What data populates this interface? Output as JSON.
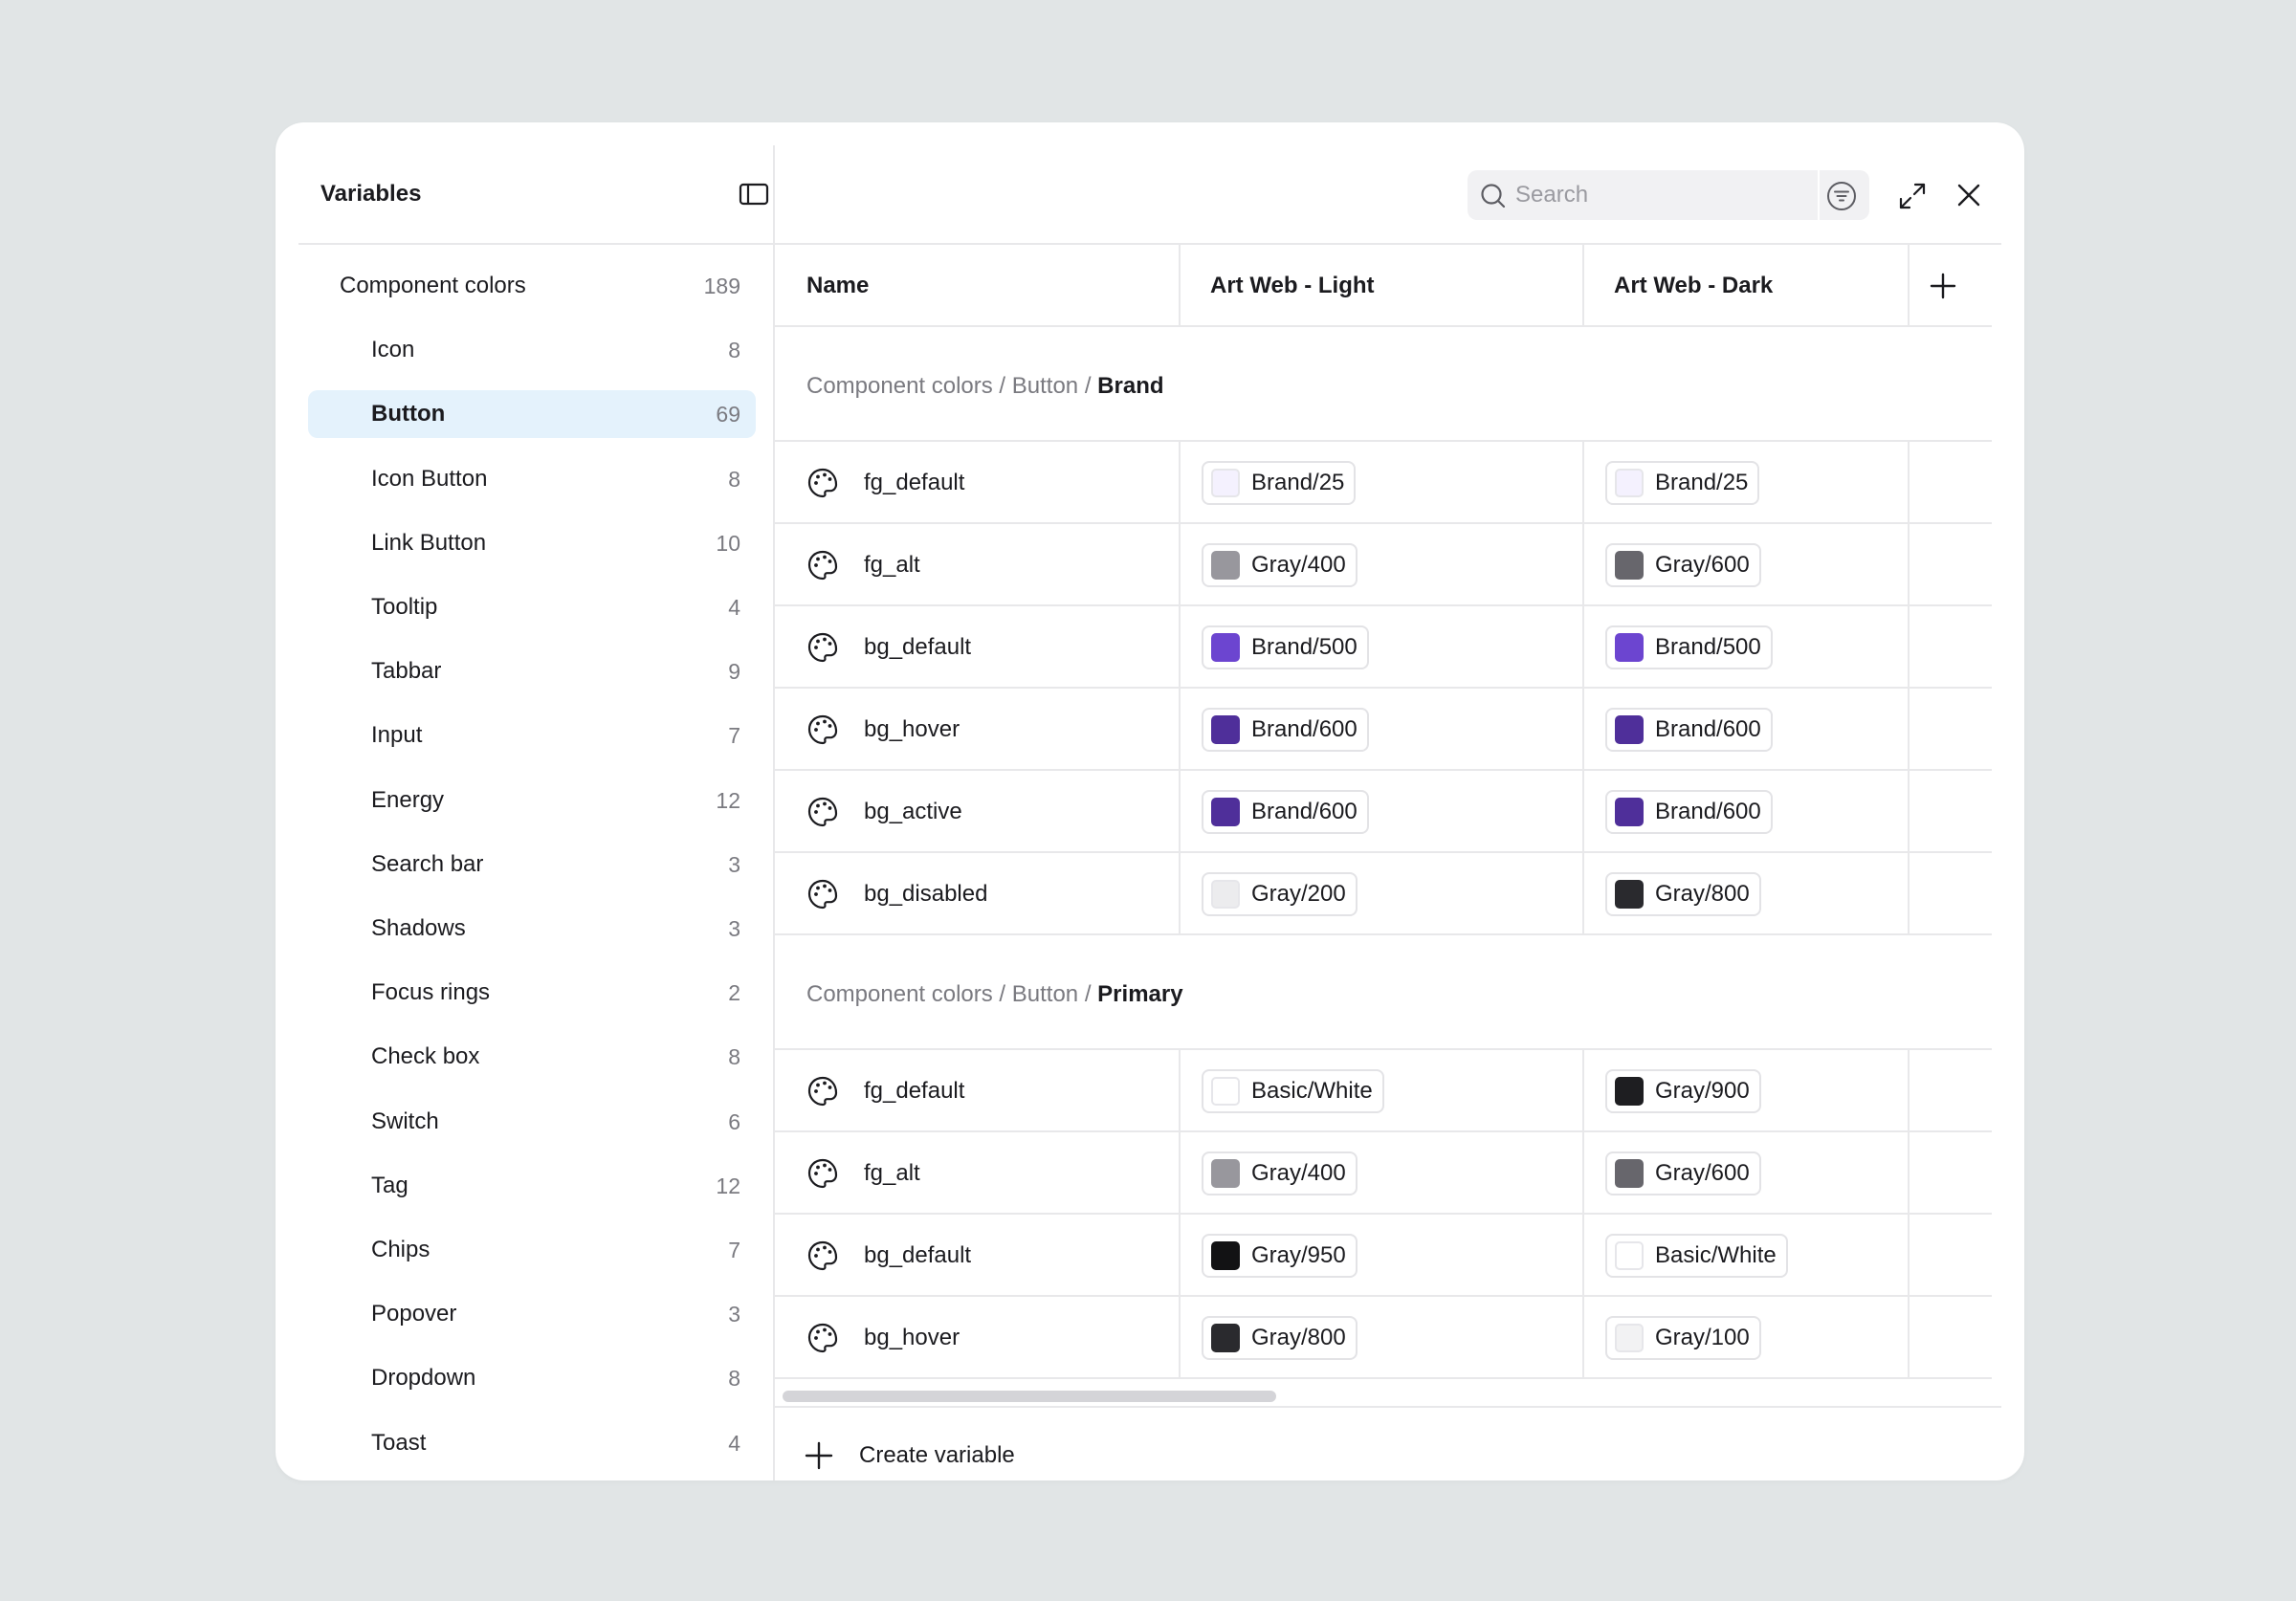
{
  "sidebar": {
    "title": "Variables",
    "items": [
      {
        "label": "Component colors",
        "count": "189",
        "level": "group",
        "selected": false
      },
      {
        "label": "Icon",
        "count": "8",
        "level": "child",
        "selected": false
      },
      {
        "label": "Button",
        "count": "69",
        "level": "child",
        "selected": true
      },
      {
        "label": "Icon Button",
        "count": "8",
        "level": "child",
        "selected": false
      },
      {
        "label": "Link Button",
        "count": "10",
        "level": "child",
        "selected": false
      },
      {
        "label": "Tooltip",
        "count": "4",
        "level": "child",
        "selected": false
      },
      {
        "label": "Tabbar",
        "count": "9",
        "level": "child",
        "selected": false
      },
      {
        "label": "Input",
        "count": "7",
        "level": "child",
        "selected": false
      },
      {
        "label": "Energy",
        "count": "12",
        "level": "child",
        "selected": false
      },
      {
        "label": "Search bar",
        "count": "3",
        "level": "child",
        "selected": false
      },
      {
        "label": "Shadows",
        "count": "3",
        "level": "child",
        "selected": false
      },
      {
        "label": "Focus rings",
        "count": "2",
        "level": "child",
        "selected": false
      },
      {
        "label": "Check box",
        "count": "8",
        "level": "child",
        "selected": false
      },
      {
        "label": "Switch",
        "count": "6",
        "level": "child",
        "selected": false
      },
      {
        "label": "Tag",
        "count": "12",
        "level": "child",
        "selected": false
      },
      {
        "label": "Chips",
        "count": "7",
        "level": "child",
        "selected": false
      },
      {
        "label": "Popover",
        "count": "3",
        "level": "child",
        "selected": false
      },
      {
        "label": "Dropdown",
        "count": "8",
        "level": "child",
        "selected": false
      },
      {
        "label": "Toast",
        "count": "4",
        "level": "child",
        "selected": false
      }
    ]
  },
  "search": {
    "placeholder": "Search",
    "value": ""
  },
  "table": {
    "columns": {
      "name": "Name",
      "mode1": "Art Web - Light",
      "mode2": "Art Web - Dark"
    },
    "sections": [
      {
        "path_prefix": "Component colors / Button / ",
        "group": "Brand",
        "rows": [
          {
            "name": "fg_default",
            "light": {
              "label": "Brand/25",
              "color": "#f4f1fe"
            },
            "dark": {
              "label": "Brand/25",
              "color": "#f4f1fe"
            }
          },
          {
            "name": "fg_alt",
            "light": {
              "label": "Gray/400",
              "color": "#98979d"
            },
            "dark": {
              "label": "Gray/600",
              "color": "#67666c"
            }
          },
          {
            "name": "bg_default",
            "light": {
              "label": "Brand/500",
              "color": "#6c45d0"
            },
            "dark": {
              "label": "Brand/500",
              "color": "#6c45d0"
            }
          },
          {
            "name": "bg_hover",
            "light": {
              "label": "Brand/600",
              "color": "#4f2f9a"
            },
            "dark": {
              "label": "Brand/600",
              "color": "#4f2f9a"
            }
          },
          {
            "name": "bg_active",
            "light": {
              "label": "Brand/600",
              "color": "#4f2f9a"
            },
            "dark": {
              "label": "Brand/600",
              "color": "#4f2f9a"
            }
          },
          {
            "name": "bg_disabled",
            "light": {
              "label": "Gray/200",
              "color": "#ececee"
            },
            "dark": {
              "label": "Gray/800",
              "color": "#2a2a2e"
            }
          }
        ]
      },
      {
        "path_prefix": "Component colors / Button / ",
        "group": "Primary",
        "rows": [
          {
            "name": "fg_default",
            "light": {
              "label": "Basic/White",
              "color": "#ffffff"
            },
            "dark": {
              "label": "Gray/900",
              "color": "#1e1e21"
            }
          },
          {
            "name": "fg_alt",
            "light": {
              "label": "Gray/400",
              "color": "#98979d"
            },
            "dark": {
              "label": "Gray/600",
              "color": "#67666c"
            }
          },
          {
            "name": "bg_default",
            "light": {
              "label": "Gray/950",
              "color": "#121214"
            },
            "dark": {
              "label": "Basic/White",
              "color": "#ffffff"
            }
          },
          {
            "name": "bg_hover",
            "light": {
              "label": "Gray/800",
              "color": "#2a2a2e"
            },
            "dark": {
              "label": "Gray/100",
              "color": "#f2f2f3"
            }
          }
        ]
      }
    ]
  },
  "footer": {
    "create_label": "Create variable"
  }
}
